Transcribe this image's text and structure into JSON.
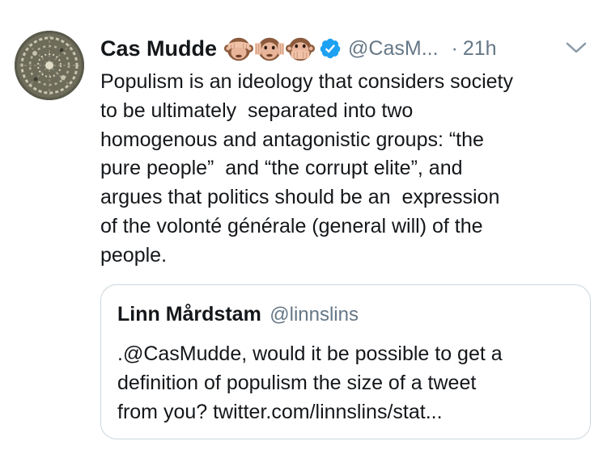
{
  "tweet": {
    "author_name": "Cas Mudde",
    "name_emojis": [
      "see-no-evil-monkey",
      "hear-no-evil-monkey",
      "speak-no-evil-monkey"
    ],
    "verified": true,
    "handle": "@CasM...",
    "separator": "·",
    "time": "21h",
    "body_lines": [
      "Populism is an ideology that considers society",
      "to be ultimately  separated into two",
      "homogenous and antagonistic groups: “the",
      "pure people”  and “the corrupt elite”, and",
      "argues that politics should be an  expression",
      "of the volonté générale (general will) of the",
      "people."
    ]
  },
  "quoted_tweet": {
    "author_name": "Linn Mårdstam",
    "handle": "@linnslins",
    "body_lines": [
      ".@CasMudde, would it be possible to get a",
      "definition of populism the size of a tweet",
      "from you? twitter.com/linnslins/stat..."
    ]
  },
  "icons": {
    "verified": "verified-badge-icon",
    "menu": "chevron-down-icon"
  },
  "colors": {
    "text": "#14171a",
    "secondary_text": "#657786",
    "verified_blue": "#1da1f2",
    "card_border": "#ccd6dd"
  }
}
